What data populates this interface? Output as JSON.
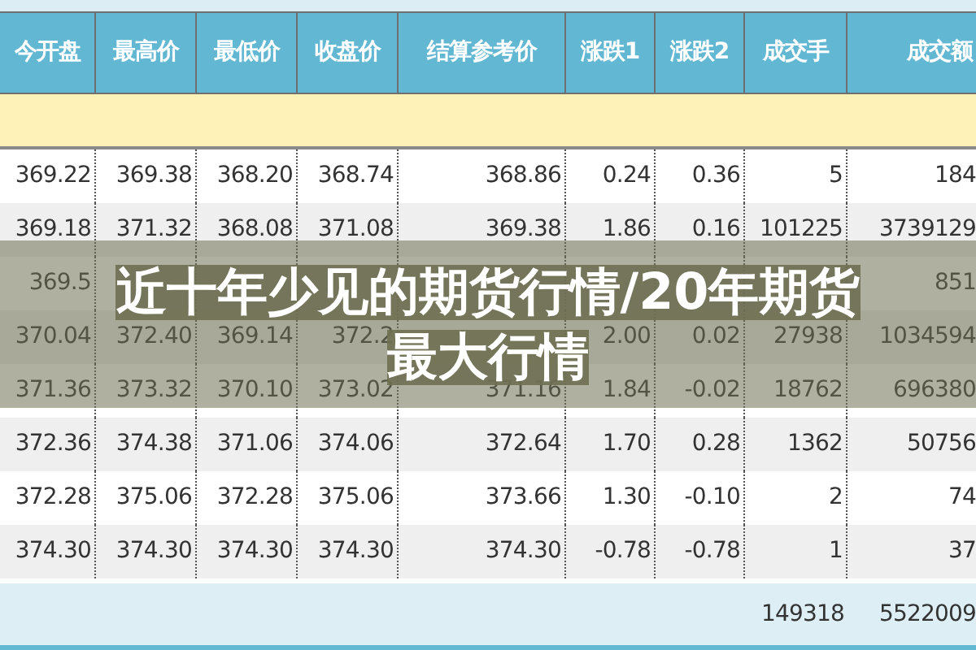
{
  "table": {
    "columns": [
      "今开盘",
      "最高价",
      "最低价",
      "收盘价",
      "结算参考价",
      "涨跌1",
      "涨跌2",
      "成交手",
      "成交额"
    ],
    "rows": [
      {
        "cells": [
          "369.22",
          "369.38",
          "368.20",
          "368.74",
          "368.86",
          "0.24",
          "0.36",
          "5",
          "184"
        ]
      },
      {
        "cells": [
          "369.18",
          "371.32",
          "368.08",
          "371.08",
          "369.38",
          "1.86",
          "0.16",
          "101225",
          "3739129"
        ]
      },
      {
        "cells": [
          "369.5",
          null,
          null,
          null,
          null,
          null,
          null,
          null,
          "851"
        ]
      },
      {
        "cells": [
          "370.04",
          "372.40",
          "369.14",
          "372.2",
          null,
          "2.00",
          "0.02",
          "27938",
          "1034594"
        ]
      },
      {
        "cells": [
          "371.36",
          "373.32",
          "370.10",
          "373.02",
          "371.16",
          "1.84",
          "-0.02",
          "18762",
          "696380"
        ]
      },
      {
        "cells": [
          "372.36",
          "374.38",
          "371.06",
          "374.06",
          "372.64",
          "1.70",
          "0.28",
          "1362",
          "50756"
        ]
      },
      {
        "cells": [
          "372.28",
          "375.06",
          "372.28",
          "375.06",
          "373.66",
          "1.30",
          "-0.10",
          "2",
          "74"
        ]
      },
      {
        "cells": [
          "374.30",
          "374.30",
          "374.30",
          "374.30",
          "374.30",
          "-0.78",
          "-0.78",
          "1",
          "37"
        ]
      }
    ],
    "totals": {
      "column_8": "149318",
      "column_9": "5522009"
    }
  },
  "banner": {
    "lines": [
      "近十年少见的期货行情/20年期货",
      "最大行情"
    ]
  }
}
